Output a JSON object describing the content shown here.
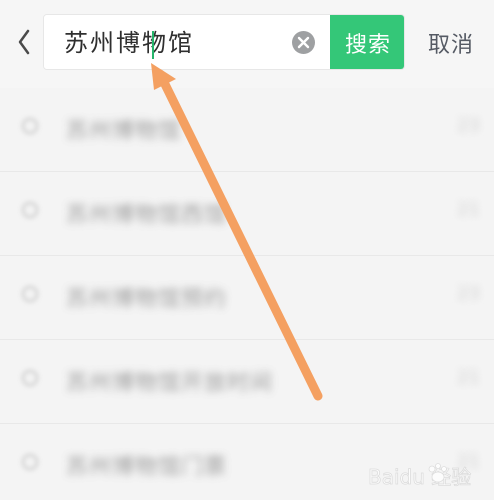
{
  "header": {
    "search_query": "苏州博物馆",
    "search_button_label": "搜索",
    "cancel_label": "取消"
  },
  "suggestions": [
    {
      "label": "苏州博物馆",
      "meta": "23"
    },
    {
      "label": "苏州博物馆西馆",
      "meta": "21"
    },
    {
      "label": "苏州博物馆预约",
      "meta": "23"
    },
    {
      "label": "苏州博物馆开放时间",
      "meta": "21"
    },
    {
      "label": "苏州博物馆门票",
      "meta": "21"
    }
  ],
  "watermark": {
    "text": "Baidu 经验"
  },
  "icons": {
    "back": "back-icon",
    "clear": "clear-icon",
    "suggestion": "history-icon",
    "annotation": "arrow-icon",
    "watermark": "paw-icon"
  },
  "colors": {
    "accent_green": "#34c778",
    "caret_green": "#25b56b",
    "arrow_orange": "#f4a061",
    "clear_gray": "#9ea0a2"
  }
}
